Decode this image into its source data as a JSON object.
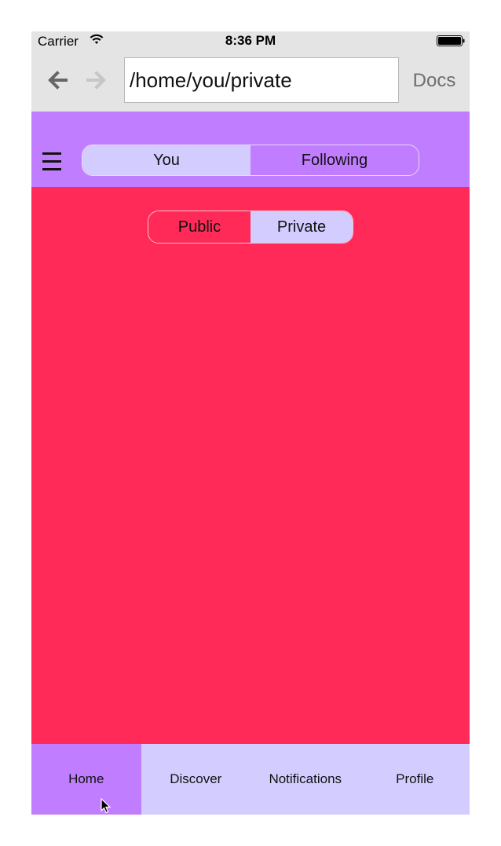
{
  "status_bar": {
    "carrier": "Carrier",
    "time": "8:36 PM",
    "icons": [
      "wifi-icon",
      "battery-icon"
    ]
  },
  "browser": {
    "back_icon": "arrow-left-icon",
    "forward_icon": "arrow-right-icon",
    "url": "/home/you/private",
    "docs_label": "Docs"
  },
  "header": {
    "menu_icon": "hamburger-icon",
    "segments": [
      {
        "label": "You",
        "selected": true
      },
      {
        "label": "Following",
        "selected": false
      }
    ]
  },
  "content": {
    "segments": [
      {
        "label": "Public",
        "selected": false
      },
      {
        "label": "Private",
        "selected": true
      }
    ]
  },
  "tab_bar": {
    "tabs": [
      {
        "label": "Home",
        "active": true
      },
      {
        "label": "Discover",
        "active": false
      },
      {
        "label": "Notifications",
        "active": false
      },
      {
        "label": "Profile",
        "active": false
      }
    ]
  },
  "colors": {
    "header_purple": "#c17dff",
    "light_lavender": "#d3ccff",
    "content_red": "#ff2a57",
    "bar_gray": "#e4e4e4"
  }
}
